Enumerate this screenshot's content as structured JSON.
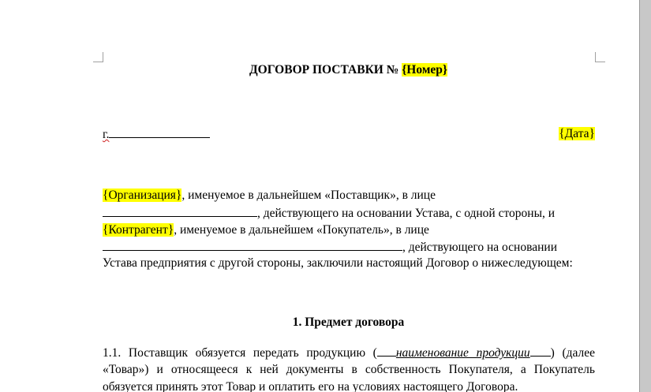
{
  "document": {
    "title_prefix": "ДОГОВОР ПОСТАВКИ №",
    "title_field": "{Номер}",
    "city_prefix": "г.",
    "date_field": "{Дата}",
    "org_field": "{Организация}",
    "line1_rest": ", именуемое в дальнейшем «Поставщик», в лице",
    "line2_rest": ", действующего на основании Устава, с одной стороны, и",
    "contractor_field": "{Контрагент}",
    "line3_rest": ", именуемое в дальнейшем «Покупатель», в лице",
    "line4_rest": ", действующего на основании",
    "line5": "Устава предприятия с другой стороны, заключили настоящий Договор о нижеследующем:",
    "section1_title": "1. Предмет договора",
    "clause_1_1_start": "1.1. Поставщик обязуется передать продукцию (",
    "product_placeholder": "наименование продукции",
    "clause_1_1_after": ") (далее",
    "clause_1_1_line2": "«Товар») и относящееся к ней документы в собственность Покупателя, а Покупатель",
    "clause_1_1_line3": "обязуется принять этот Товар и оплатить его на условиях настоящего Договора."
  }
}
